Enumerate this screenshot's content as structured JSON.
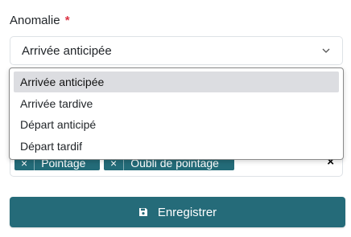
{
  "field": {
    "label": "Anomalie",
    "required_mark": "*",
    "selected_value": "Arrivée anticipée"
  },
  "dropdown": {
    "options": [
      {
        "label": "Arrivée anticipée",
        "selected": true
      },
      {
        "label": "Arrivée tardive",
        "selected": false
      },
      {
        "label": "Départ anticipé",
        "selected": false
      },
      {
        "label": "Départ tardif",
        "selected": false
      }
    ]
  },
  "tags_field": {
    "tags": [
      {
        "remove": "×",
        "label": "Pointage"
      },
      {
        "remove": "×",
        "label": "Oubli de pointage"
      }
    ],
    "clear_all": "×"
  },
  "submit": {
    "label": "Enregistrer",
    "icon": "save-icon"
  },
  "colors": {
    "accent": "#256b79",
    "required": "#dc3545",
    "option_highlight": "#dcdde1"
  }
}
